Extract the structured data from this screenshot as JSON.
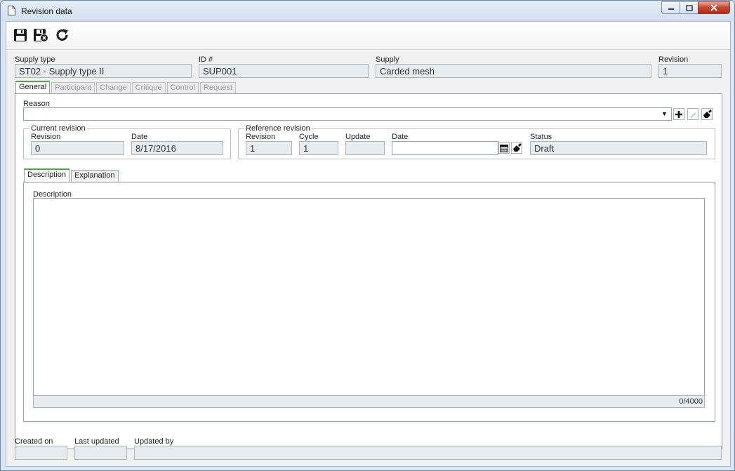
{
  "window": {
    "title": "Revision data"
  },
  "toolbar": {
    "items": [
      {
        "name": "save",
        "icon": "floppy-disk-icon"
      },
      {
        "name": "save-and-close",
        "icon": "floppy-disk-close-icon"
      },
      {
        "name": "refresh",
        "icon": "refresh-icon"
      }
    ]
  },
  "header": {
    "supply_type_label": "Supply type",
    "supply_type_value": "ST02 - Supply type II",
    "id_label": "ID #",
    "id_value": "SUP001",
    "supply_label": "Supply",
    "supply_value": "Carded mesh",
    "revision_label": "Revision",
    "revision_value": "1"
  },
  "tabs": [
    {
      "label": "General",
      "active": true
    },
    {
      "label": "Participant",
      "active": false
    },
    {
      "label": "Change",
      "active": false
    },
    {
      "label": "Critique",
      "active": false
    },
    {
      "label": "Control",
      "active": false
    },
    {
      "label": "Request",
      "active": false
    }
  ],
  "general": {
    "reason_label": "Reason",
    "reason_value": "",
    "current_revision": {
      "legend": "Current revision",
      "revision_label": "Revision",
      "revision_value": "0",
      "date_label": "Date",
      "date_value": "8/17/2016"
    },
    "reference_revision": {
      "legend": "Reference revision",
      "revision_label": "Revision",
      "revision_value": "1",
      "cycle_label": "Cycle",
      "cycle_value": "1",
      "update_label": "Update",
      "update_value": "",
      "date_label": "Date",
      "date_value": "",
      "status_label": "Status",
      "status_value": "Draft"
    },
    "subtabs": [
      {
        "label": "Description",
        "active": true
      },
      {
        "label": "Explanation",
        "active": false
      }
    ],
    "description_label": "Description",
    "description_value": "",
    "description_counter": "0/4000"
  },
  "footer": {
    "created_on_label": "Created on",
    "created_on_value": "",
    "last_updated_label": "Last updated",
    "last_updated_value": "",
    "updated_by_label": "Updated by",
    "updated_by_value": ""
  },
  "colors": {
    "active_tab_accent": "#4aa84a",
    "close_button": "#c4452f"
  }
}
